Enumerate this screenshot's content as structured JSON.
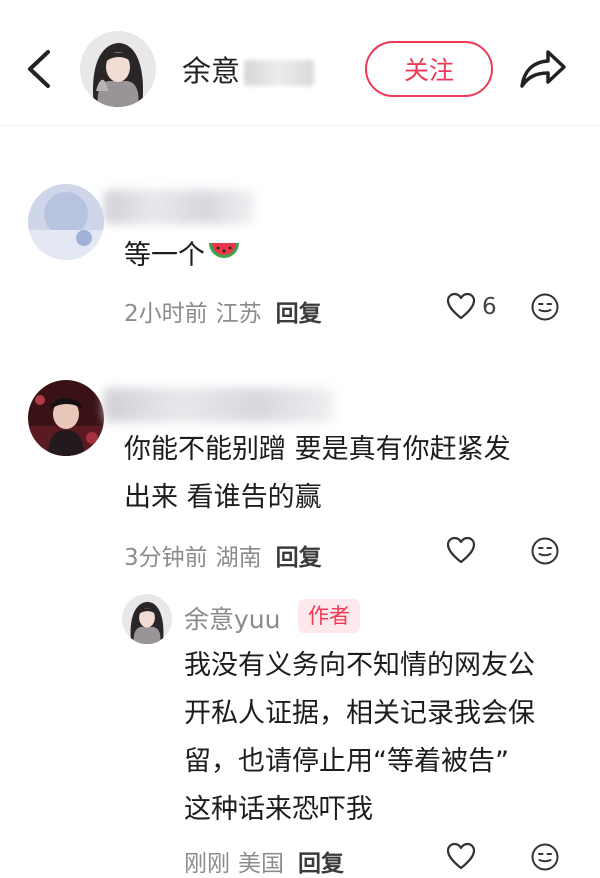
{
  "header": {
    "username": "余意",
    "follow_label": "关注",
    "icons": {
      "back": "chevron-left-icon",
      "share": "share-arrow-icon"
    }
  },
  "comments": [
    {
      "text": "等一个",
      "emoji": "watermelon",
      "time": "2小时前",
      "region": "江苏",
      "reply_label": "回复",
      "likes": "6"
    },
    {
      "text_line1": "你能不能别蹭 要是真有你赶紧发",
      "text_line2": "出来 看谁告的赢",
      "time": "3分钟前",
      "region": "湖南",
      "reply_label": "回复"
    }
  ],
  "reply": {
    "name": "余意yuu",
    "author_label": "作者",
    "lines": [
      "我没有义务向不知情的网友公",
      "开私人证据，相关记录我会保",
      "留，也请停止用“等着被告”",
      "这种话来恐吓我"
    ],
    "time": "刚刚",
    "region": "美国",
    "reply_label": "回复"
  },
  "colors": {
    "accent": "#ee3a56",
    "meta": "#8c8c8c"
  }
}
